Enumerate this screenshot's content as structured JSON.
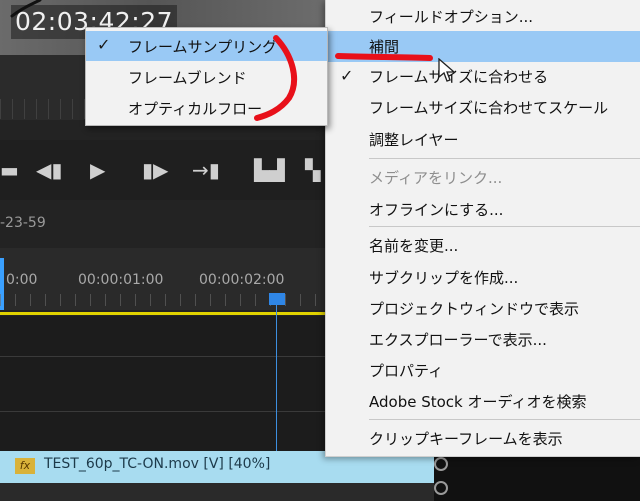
{
  "editor": {
    "timecode": "02:03:42:27",
    "ruler_date": "-23-59",
    "ruler_labels": [
      "0:00",
      "00:00:01:00",
      "00:00:02:00"
    ],
    "clip_label": "TEST_60p_TC-ON.mov [V] [40%]",
    "fx_label": "fx"
  },
  "context_menu": {
    "items": [
      {
        "label": "フィールドオプション...",
        "checked": false,
        "disabled": false,
        "active": false
      },
      {
        "label": "補間",
        "checked": false,
        "disabled": false,
        "active": true
      },
      {
        "label": "フレームサイズに合わせる",
        "checked": true,
        "disabled": false,
        "active": false
      },
      {
        "label": "フレームサイズに合わせてスケール",
        "checked": false,
        "disabled": false,
        "active": false
      },
      {
        "label": "調整レイヤー",
        "checked": false,
        "disabled": false,
        "active": false
      },
      {
        "label": "メディアをリンク...",
        "checked": false,
        "disabled": true,
        "active": false
      },
      {
        "label": "オフラインにする...",
        "checked": false,
        "disabled": false,
        "active": false
      },
      {
        "label": "名前を変更...",
        "checked": false,
        "disabled": false,
        "active": false
      },
      {
        "label": "サブクリップを作成...",
        "checked": false,
        "disabled": false,
        "active": false
      },
      {
        "label": "プロジェクトウィンドウで表示",
        "checked": false,
        "disabled": false,
        "active": false
      },
      {
        "label": "エクスプローラーで表示...",
        "checked": false,
        "disabled": false,
        "active": false
      },
      {
        "label": "プロパティ",
        "checked": false,
        "disabled": false,
        "active": false
      },
      {
        "label": "Adobe Stock オーディオを検索",
        "checked": false,
        "disabled": false,
        "active": false
      },
      {
        "label": "クリップキーフレームを表示",
        "checked": false,
        "disabled": false,
        "active": false
      }
    ]
  },
  "submenu": {
    "items": [
      {
        "label": "フレームサンプリング",
        "checked": true,
        "active": true
      },
      {
        "label": "フレームブレンド",
        "checked": false,
        "active": false
      },
      {
        "label": "オプティカルフロー",
        "checked": false,
        "active": false
      }
    ]
  },
  "colors": {
    "menu_highlight": "#99c9f5",
    "annotation_red": "#e8101a",
    "playhead_blue": "#3d8fe0",
    "clip_blue": "#a8dcf0"
  }
}
